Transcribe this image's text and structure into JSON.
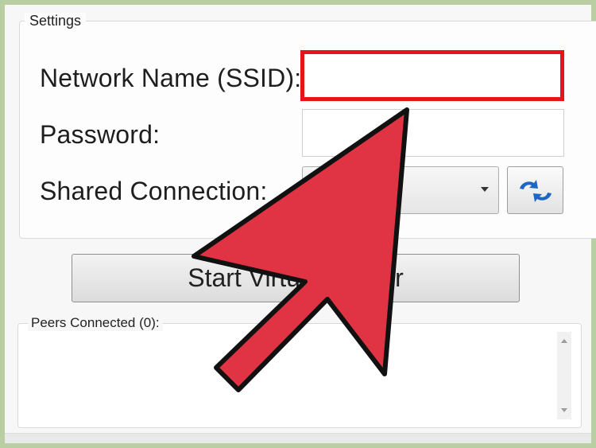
{
  "settings": {
    "legend": "Settings",
    "ssid_label": "Network Name (SSID):",
    "ssid_value": "",
    "password_label": "Password:",
    "password_value": "",
    "shared_label": "Shared Connection:",
    "shared_value": ""
  },
  "start_button": {
    "label": "Start Virtual Router"
  },
  "peers": {
    "legend": "Peers Connected (0):"
  },
  "colors": {
    "highlight_border": "#e5141b",
    "arrow_fill": "#e03344",
    "page_border": "#b9cfa3"
  },
  "icons": {
    "refresh": "refresh-icon",
    "dropdown": "chevron-down-icon",
    "scroll_up": "scroll-up-icon",
    "scroll_down": "scroll-down-icon",
    "pointer": "pointer-arrow-icon"
  }
}
